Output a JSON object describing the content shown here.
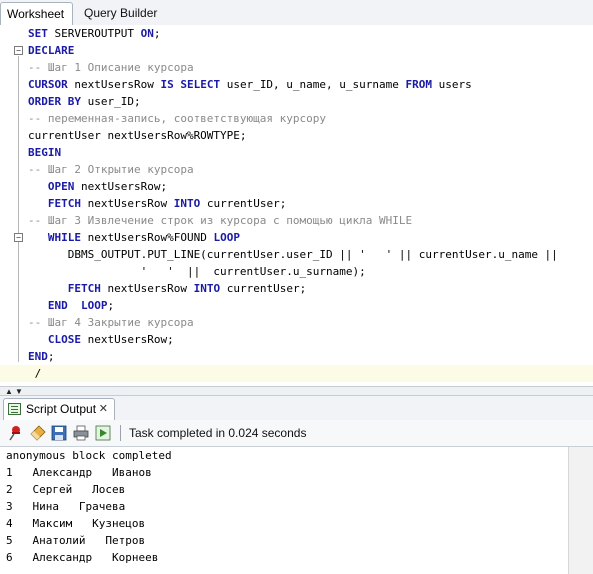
{
  "tabs": [
    {
      "label": "Worksheet"
    },
    {
      "label": "Query Builder"
    }
  ],
  "editor": {
    "lines": [
      [
        {
          "t": "SET",
          "k": "kw"
        },
        {
          "t": " SERVEROUTPUT ",
          "k": "st"
        },
        {
          "t": "ON",
          "k": "kw"
        },
        {
          "t": ";",
          "k": "st"
        }
      ],
      [
        {
          "t": "DECLARE",
          "k": "kw"
        }
      ],
      [
        {
          "t": "-- Шаг 1 Описание курсора",
          "k": "cm"
        }
      ],
      [
        {
          "t": "CURSOR",
          "k": "kw"
        },
        {
          "t": " nextUsersRow ",
          "k": "st"
        },
        {
          "t": "IS SELECT",
          "k": "kw"
        },
        {
          "t": " user_ID, u_name, u_surname ",
          "k": "st"
        },
        {
          "t": "FROM",
          "k": "kw"
        },
        {
          "t": " users",
          "k": "st"
        }
      ],
      [
        {
          "t": "ORDER BY",
          "k": "kw"
        },
        {
          "t": " user_ID;",
          "k": "st"
        }
      ],
      [
        {
          "t": "-- переменная-запись, соответствующая курсору",
          "k": "cm"
        }
      ],
      [
        {
          "t": "currentUser nextUsersRow%ROWTYPE;",
          "k": "st"
        }
      ],
      [
        {
          "t": "BEGIN",
          "k": "kw"
        }
      ],
      [
        {
          "t": "-- Шаг 2 Открытие курсора",
          "k": "cm"
        }
      ],
      [
        {
          "t": "   ",
          "k": "st"
        },
        {
          "t": "OPEN",
          "k": "kw"
        },
        {
          "t": " nextUsersRow;",
          "k": "st"
        }
      ],
      [
        {
          "t": "   ",
          "k": "st"
        },
        {
          "t": "FETCH",
          "k": "kw"
        },
        {
          "t": " nextUsersRow ",
          "k": "st"
        },
        {
          "t": "INTO",
          "k": "kw"
        },
        {
          "t": " currentUser;",
          "k": "st"
        }
      ],
      [
        {
          "t": "-- Шаг 3 Извлечение строк из курсора с помощью цикла WHILE",
          "k": "cm"
        }
      ],
      [
        {
          "t": "   ",
          "k": "st"
        },
        {
          "t": "WHILE",
          "k": "kw"
        },
        {
          "t": " nextUsersRow%FOUND ",
          "k": "st"
        },
        {
          "t": "LOOP",
          "k": "kw"
        }
      ],
      [
        {
          "t": "      DBMS_OUTPUT.PUT_LINE(currentUser.user_ID || '   ' || currentUser.u_name ||",
          "k": "st"
        }
      ],
      [
        {
          "t": "                 '   '  ||  currentUser.u_surname);",
          "k": "st"
        }
      ],
      [
        {
          "t": "      ",
          "k": "st"
        },
        {
          "t": "FETCH",
          "k": "kw"
        },
        {
          "t": " nextUsersRow ",
          "k": "st"
        },
        {
          "t": "INTO",
          "k": "kw"
        },
        {
          "t": " currentUser;",
          "k": "st"
        }
      ],
      [
        {
          "t": "   ",
          "k": "st"
        },
        {
          "t": "END",
          "k": "kw"
        },
        {
          "t": "  ",
          "k": "st"
        },
        {
          "t": "LOOP",
          "k": "kw"
        },
        {
          "t": ";",
          "k": "st"
        }
      ],
      [
        {
          "t": "-- Шаг 4 Закрытие курсора",
          "k": "cm"
        }
      ],
      [
        {
          "t": "   ",
          "k": "st"
        },
        {
          "t": "CLOSE",
          "k": "kw"
        },
        {
          "t": " nextUsersRow;",
          "k": "st"
        }
      ],
      [
        {
          "t": "END",
          "k": "kw"
        },
        {
          "t": ";",
          "k": "st"
        }
      ],
      [
        {
          "t": " /",
          "k": "st"
        }
      ]
    ]
  },
  "output_panel": {
    "tab_label": "Script Output",
    "close_glyph": "✕",
    "status": "Task completed in 0.024 seconds",
    "toolbar_icons": [
      "pin-icon",
      "eraser-icon",
      "save-icon",
      "print-icon",
      "run-script-icon"
    ],
    "lines": [
      "anonymous block completed",
      "1   Александр   Иванов",
      "2   Сергей   Лосев",
      "3   Нина   Грачева",
      "4   Максим   Кузнецов",
      "5   Анатолий   Петров",
      "6   Александр   Корнеев"
    ]
  },
  "colors": {
    "keyword": "#1a1aa6",
    "comment": "#8a8a8a",
    "current_line": "#fbfbe6"
  }
}
